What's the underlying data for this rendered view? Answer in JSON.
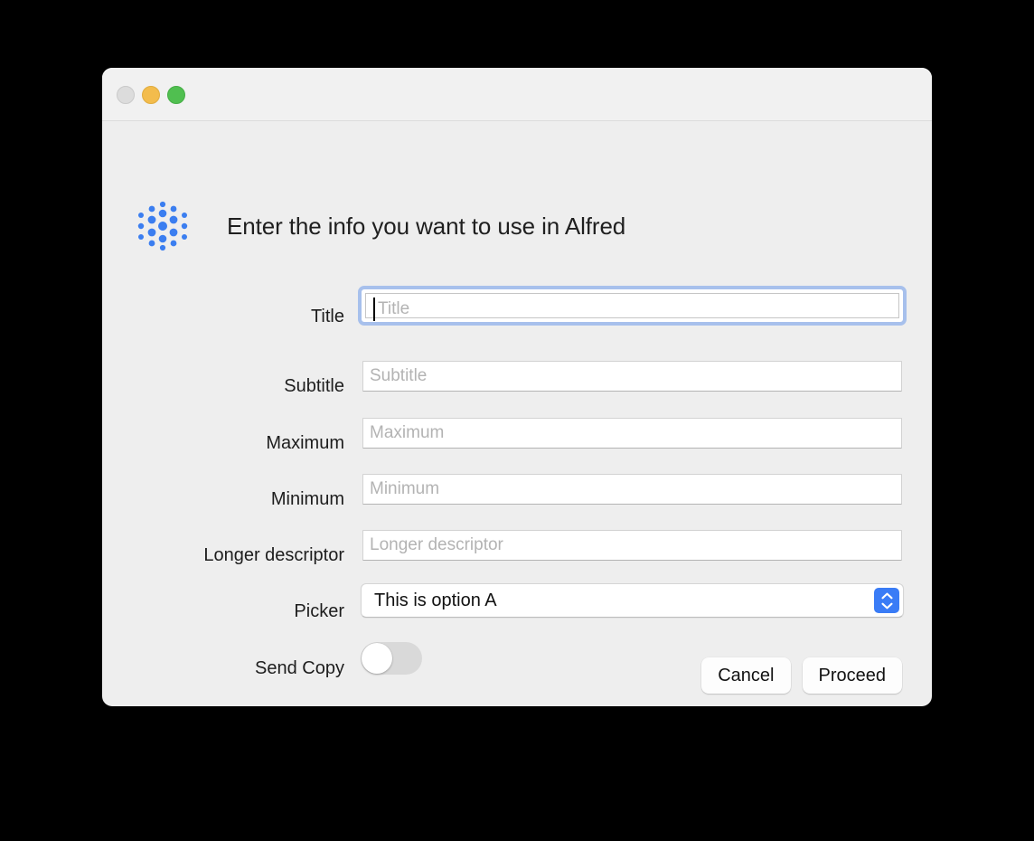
{
  "window": {
    "traffic_lights": [
      {
        "name": "close",
        "color": "#dcdcdc",
        "state": "inactive"
      },
      {
        "name": "minimize",
        "color": "#f3bc4c",
        "state": "active"
      },
      {
        "name": "maximize",
        "color": "#50bf50",
        "state": "active"
      }
    ]
  },
  "dialog": {
    "icon": "alfred-dots-icon",
    "icon_color": "#3b7ef0",
    "headline": "Enter the info you want to use in Alfred"
  },
  "form": {
    "fields": [
      {
        "label": "Title",
        "placeholder": "Title",
        "value": "",
        "type": "text",
        "focused": true
      },
      {
        "label": "Subtitle",
        "placeholder": "Subtitle",
        "value": "",
        "type": "text",
        "focused": false
      },
      {
        "label": "Maximum",
        "placeholder": "Maximum",
        "value": "",
        "type": "text",
        "focused": false
      },
      {
        "label": "Minimum",
        "placeholder": "Minimum",
        "value": "",
        "type": "text",
        "focused": false
      },
      {
        "label": "Longer descriptor",
        "placeholder": "Longer descriptor",
        "value": "",
        "type": "text",
        "focused": false
      }
    ],
    "picker": {
      "label": "Picker",
      "selected": "This is option A",
      "stepper_icon": "chevron-up-down-icon",
      "accent_color": "#3a7cf6"
    },
    "toggle": {
      "label": "Send Copy",
      "state": "off",
      "track_color": "#d9d9d9"
    }
  },
  "actions": {
    "cancel_label": "Cancel",
    "proceed_label": "Proceed"
  }
}
